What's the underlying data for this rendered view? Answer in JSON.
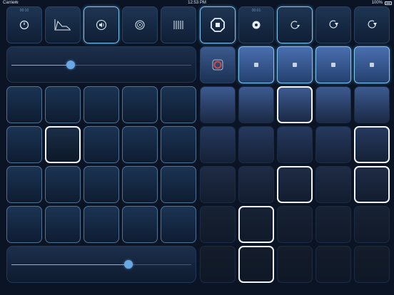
{
  "status": {
    "carrier": "Carrier",
    "time": "12:53 PM",
    "battery": "100%"
  },
  "top_left": [
    {
      "label": "00:10",
      "icon": "timer-icon",
      "active": false
    },
    {
      "label": "",
      "icon": "envelope-icon",
      "active": false
    },
    {
      "label": "",
      "icon": "speaker-icon",
      "active": true
    },
    {
      "label": "",
      "icon": "vinyl-icon",
      "active": false
    },
    {
      "label": "",
      "icon": "grid-lines-icon",
      "active": false
    }
  ],
  "top_right": [
    {
      "label": "",
      "icon": "stop-octagon-icon",
      "active": true
    },
    {
      "label": "00:01",
      "icon": "record-dot-icon",
      "active": false
    },
    {
      "label": "",
      "icon": "loop-icon",
      "active": true
    },
    {
      "label": "",
      "icon": "loop-down-icon",
      "active": false
    },
    {
      "label": "",
      "icon": "loop-down-icon",
      "active": false
    }
  ],
  "slider_top": {
    "value": 0.33
  },
  "slider_bottom": {
    "value": 0.65
  },
  "record_button_icon": "record-icon",
  "fx_buttons": [
    {
      "icon": "stop-square-icon"
    },
    {
      "icon": "stop-square-icon"
    },
    {
      "icon": "stop-square-icon"
    },
    {
      "icon": "stop-square-icon"
    }
  ],
  "left_grid": {
    "rows": 4,
    "cols": 5,
    "selected": [
      [
        1,
        1
      ]
    ]
  },
  "right_grid": {
    "rows": 5,
    "cols": 5,
    "row_colors": [
      "#3d5a91",
      "#263a5f",
      "#1f2c45",
      "#172234",
      "#141c2a"
    ],
    "selected": [
      [
        0,
        2
      ],
      [
        1,
        4
      ],
      [
        2,
        2
      ],
      [
        2,
        4
      ],
      [
        3,
        1
      ],
      [
        4,
        1
      ]
    ]
  },
  "colors": {
    "accent": "#7ec7f5",
    "selected": "#f2f6fb",
    "background": "#0a1424"
  }
}
